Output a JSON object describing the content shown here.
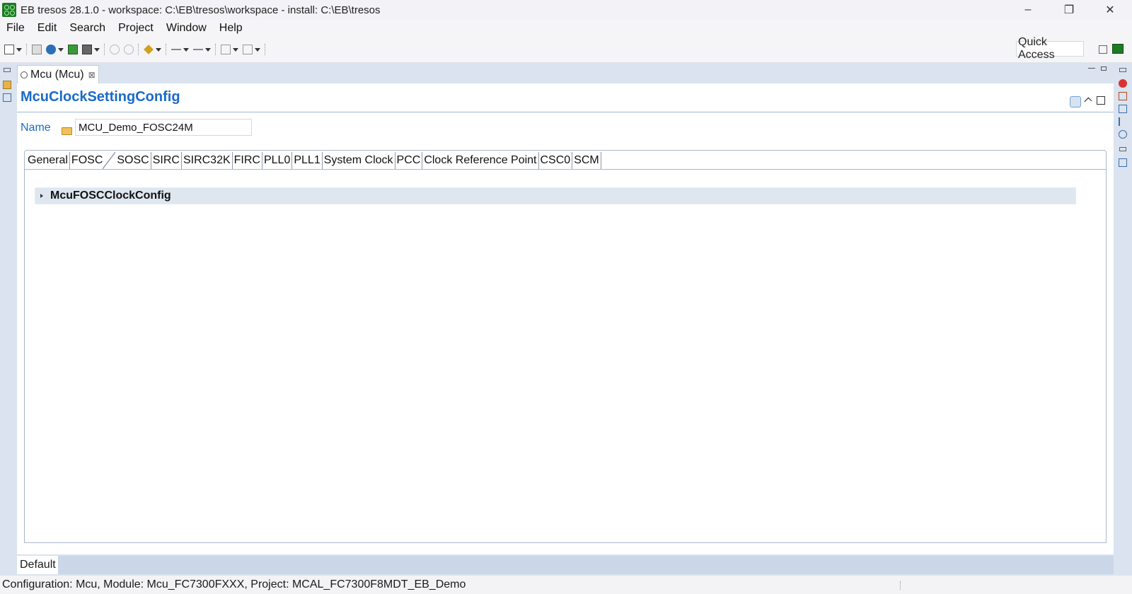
{
  "window": {
    "title": "EB tresos 28.1.0 - workspace: C:\\EB\\tresos\\workspace - install: C:\\EB\\tresos",
    "minimize": "–",
    "maximize": "❐",
    "close": "✕"
  },
  "menu": [
    "File",
    "Edit",
    "Search",
    "Project",
    "Window",
    "Help"
  ],
  "toolbar": {
    "quick_access": "Quick Access"
  },
  "editor": {
    "tab_label": "Mcu (Mcu)",
    "tab_close": "⊠",
    "form_title": "McuClockSettingConfig",
    "name_label": "Name",
    "name_value": "MCU_Demo_FOSC24M",
    "tabs": [
      "General",
      "FOSC",
      "SOSC",
      "SIRC",
      "SIRC32K",
      "FIRC",
      "PLL0",
      "PLL1",
      "System Clock",
      "PCC",
      "Clock Reference Point",
      "CSC0",
      "SCM"
    ],
    "active_tab": "FOSC",
    "section_title": "McuFOSCClockConfig"
  },
  "bottom": {
    "tab_label": "Default"
  },
  "status": {
    "text": "Configuration: Mcu, Module: Mcu_FC7300FXXX, Project: MCAL_FC7300F8MDT_EB_Demo"
  },
  "colors": {
    "accent": "#1b6ac9",
    "background": "#dae3ef",
    "logo_green": "#1e7a25"
  }
}
